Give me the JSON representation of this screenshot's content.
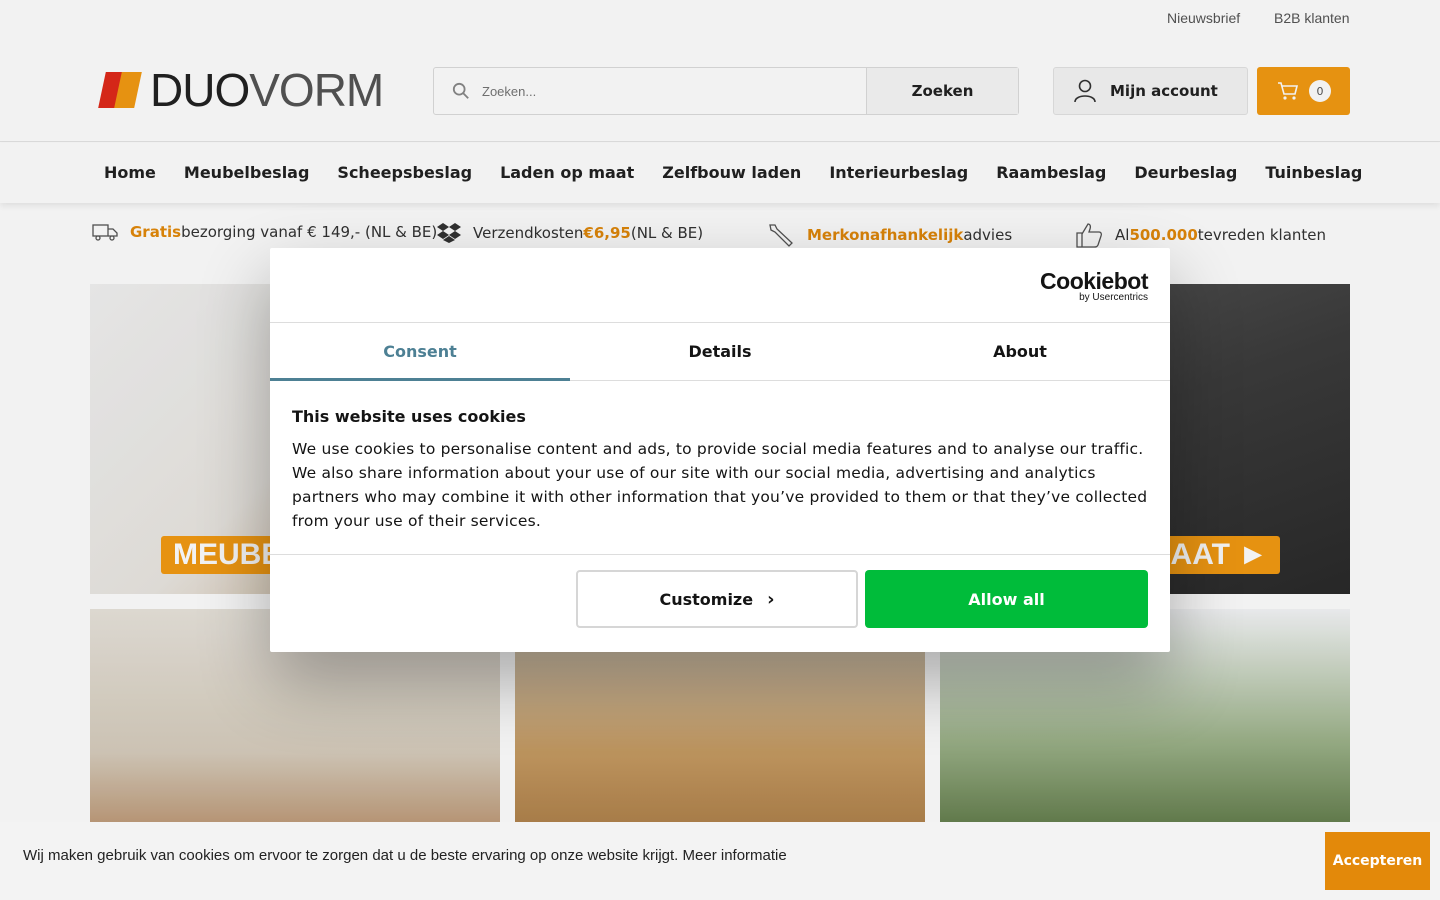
{
  "topbar": {
    "links": [
      "Nieuwsbrief",
      "B2B klanten"
    ]
  },
  "header": {
    "logo": {
      "part1": "DUO",
      "part2": "VORM"
    },
    "search": {
      "placeholder": "Zoeken...",
      "button": "Zoeken"
    },
    "account": {
      "label": "Mijn account"
    },
    "cart": {
      "count": "0"
    }
  },
  "nav": {
    "items": [
      "Home",
      "Meubelbeslag",
      "Scheepsbeslag",
      "Laden op maat",
      "Zelfbouw laden",
      "Interieurbeslag",
      "Raambeslag",
      "Deurbeslag",
      "Tuinbeslag"
    ]
  },
  "usps": [
    {
      "icon": "truck-icon",
      "highlight": "Gratis",
      "text": " bezorging vanaf € 149,- (NL & BE)"
    },
    {
      "icon": "dropbox-icon",
      "text_before": "Verzendkosten ",
      "highlight": "€6,95",
      "text": " (NL & BE)"
    },
    {
      "icon": "wrench-icon",
      "highlight": "Merkonafhankelijk",
      "text": " advies"
    },
    {
      "icon": "thumbs-up-icon",
      "text_before": "Al ",
      "highlight": "500.000",
      "text": " tevreden klanten"
    }
  ],
  "tiles": {
    "tile1_label": "MEUBE",
    "tile2_label": "MAAT ►"
  },
  "dialog": {
    "brand": "Cookiebot",
    "brand_sub": "by Usercentrics",
    "tabs": [
      "Consent",
      "Details",
      "About"
    ],
    "active_tab": "Consent",
    "title": "This website uses cookies",
    "text": "We use cookies to personalise content and ads, to provide social media features and to analyse our traffic. We also share information about your use of our site with our social media, advertising and analytics partners who may combine it with other information that you’ve provided to them or that they’ve collected from your use of their services.",
    "customize": "Customize",
    "allow_all": "Allow all"
  },
  "cookiebar": {
    "text": "Wij maken gebruik van cookies om ervoor te zorgen dat u de beste ervaring op onze website krijgt.",
    "link": "Meer informatie",
    "button": "Accepteren"
  },
  "colors": {
    "brand_orange": "#f39a12",
    "accent_green": "#00bc3a",
    "tab_active": "#4d8094"
  }
}
